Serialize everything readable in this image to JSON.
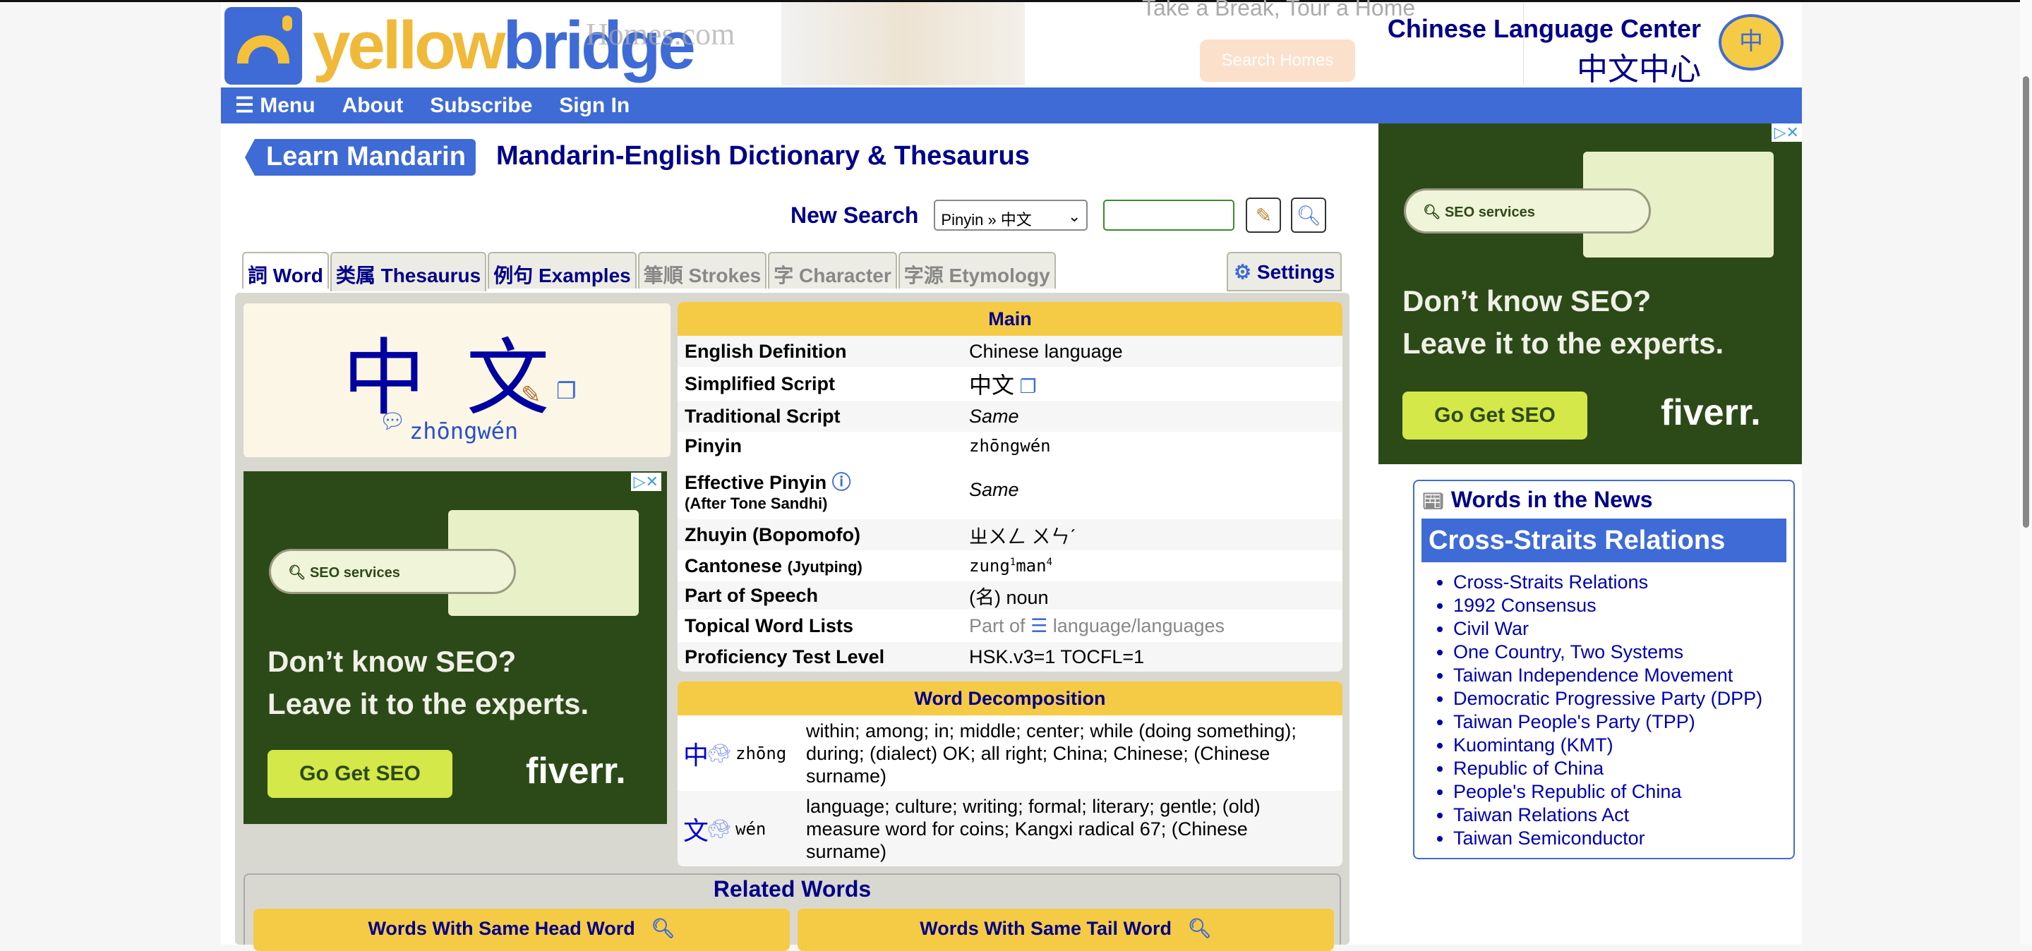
{
  "header": {
    "logo_text_a": "yellow",
    "logo_text_b": "bridge",
    "homes_ad_brand": "Homes.com",
    "homes_ad_tagline": "Take a Break, Tour a Home",
    "homes_ad_button": "Search Homes",
    "clc_title": "Chinese Language Center",
    "clc_chinese": "中文中心",
    "clc_icon_char": "中"
  },
  "nav": {
    "menu": "Menu",
    "about": "About",
    "subscribe": "Subscribe",
    "sign_in": "Sign In"
  },
  "page": {
    "learn_mandarin": "Learn Mandarin",
    "title": "Mandarin-English Dictionary & Thesaurus"
  },
  "search": {
    "label": "New Search",
    "mode": "Pinyin » 中文",
    "value": ""
  },
  "tabs": [
    {
      "label": "詞 Word"
    },
    {
      "label": "类属 Thesaurus"
    },
    {
      "label": "例句 Examples"
    },
    {
      "label": "筆順 Strokes"
    },
    {
      "label": "字 Character"
    },
    {
      "label": "字源 Etymology"
    }
  ],
  "settings": "Settings",
  "word": {
    "hanzi": "中 文",
    "pinyin": "zhōngwén"
  },
  "ad": {
    "search_text": "SEO services",
    "headline1": "Don’t know SEO?",
    "headline2": "Leave it to the experts.",
    "cta": "Go Get SEO",
    "brand": "fiverr."
  },
  "main": {
    "header": "Main",
    "rows": [
      {
        "k": "English Definition",
        "v": "Chinese language"
      },
      {
        "k": "Simplified Script",
        "v": "中文"
      },
      {
        "k": "Traditional Script",
        "v": "Same"
      },
      {
        "k": "Pinyin",
        "v": "zhōngwén"
      },
      {
        "k": "Effective Pinyin",
        "sub": "(After Tone Sandhi)",
        "v": "Same"
      },
      {
        "k": "Zhuyin (Bopomofo)",
        "v": "ㄓㄨㄥ ㄨㄣˊ"
      },
      {
        "k": "Cantonese",
        "sub": "(Jyutping)",
        "v1": "zung",
        "s1": "1",
        "v2": "man",
        "s2": "4"
      },
      {
        "k": "Part of Speech",
        "v": "(名) noun"
      },
      {
        "k": "Topical Word Lists",
        "pre": "Part of",
        "v": "language/languages"
      },
      {
        "k": "Proficiency Test Level",
        "v": "HSK.v3=1 TOCFL=1"
      }
    ]
  },
  "decomp": {
    "header": "Word Decomposition",
    "rows": [
      {
        "char": "中",
        "pinyin": "zhōng",
        "def": "within; among; in; middle; center; while (doing something); during; (dialect) OK; all right; China; Chinese; (Chinese surname)"
      },
      {
        "char": "文",
        "pinyin": "wén",
        "def": "language; culture; writing; formal; literary; gentle; (old) measure word for coins; Kangxi radical 67; (Chinese surname)"
      }
    ]
  },
  "related": {
    "title": "Related Words",
    "head": "Words With Same Head Word",
    "tail": "Words With Same Tail Word"
  },
  "news": {
    "title": "Words in the News",
    "topic": "Cross-Straits Relations",
    "items": [
      "Cross-Straits Relations",
      "1992 Consensus",
      "Civil War",
      "One Country, Two Systems",
      "Taiwan Independence Movement",
      "Democratic Progressive Party (DPP)",
      "Taiwan People's Party (TPP)",
      "Kuomintang (KMT)",
      "Republic of China",
      "People's Republic of China",
      "Taiwan Relations Act",
      "Taiwan Semiconductor"
    ]
  },
  "colors": {
    "brand_blue": "#3f6bd6",
    "navy": "#000088",
    "yellow": "#f5cb45",
    "panel": "#d8d8d0"
  }
}
